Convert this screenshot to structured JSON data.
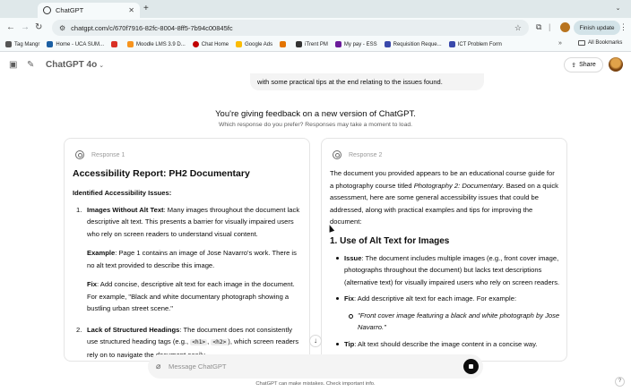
{
  "browser": {
    "tab_title": "ChatGPT",
    "tab_close": "✕",
    "new_tab": "+",
    "url": "chatgpt.com/c/670f7916-82fc-8004-8ff5-7b94c00845fc",
    "finish_update": "Finish update",
    "bookmarks": [
      {
        "label": "Tag Mangr",
        "icon_color": "#555555"
      },
      {
        "label": "Home - UCA SUM...",
        "icon_color": "#1b5fa3"
      },
      {
        "label": "",
        "icon_color": "#d93025"
      },
      {
        "label": "Moodle LMS 3.9 D...",
        "icon_color": "#f7941e"
      },
      {
        "label": "Chat Home",
        "icon_color": "#c00000"
      },
      {
        "label": "Google Ads",
        "icon_color": "#fbbc04"
      },
      {
        "label": "",
        "icon_color": "#e37400"
      },
      {
        "label": "iTrent PM",
        "icon_color": "#333333"
      },
      {
        "label": "My pay - ESS",
        "icon_color": "#6a1b9a"
      },
      {
        "label": "Requisition Reque...",
        "icon_color": "#3949ab"
      },
      {
        "label": "ICT Problem Form",
        "icon_color": "#3949ab"
      }
    ],
    "bookmarks_more": "»",
    "all_bookmarks": "All Bookmarks"
  },
  "header": {
    "model": "ChatGPT 4o",
    "share": "Share"
  },
  "prior_message": "with some practical tips at the end relating to the issues found.",
  "feedback": {
    "title": "You're giving feedback on a new version of ChatGPT.",
    "subtitle": "Which response do you prefer? Responses may take a moment to load."
  },
  "response1": {
    "label": "Response 1",
    "heading": "Accessibility Report: PH2 Documentary",
    "subheading": "Identified Accessibility Issues:",
    "item1_num": "1.",
    "item1_title": "Images Without Alt Text",
    "item1_text": ": Many images throughout the document lack descriptive alt text. This presents a barrier for visually impaired users who rely on screen readers to understand visual content.",
    "item1_example_label": "Example",
    "item1_example": ": Page 1 contains an image of Jose Navarro's work. There is no alt text provided to describe this image.",
    "item1_fix_label": "Fix",
    "item1_fix": ": Add concise, descriptive alt text for each image in the document. For example, \"Black and white documentary photograph showing a bustling urban street scene.\"",
    "item2_num": "2.",
    "item2_title": "Lack of Structured Headings",
    "item2_text_a": ": The document does not consistently use structured heading tags (e.g., ",
    "item2_code1": "<h1>",
    "item2_sep": ", ",
    "item2_code2": "<h2>",
    "item2_text_b": "), which screen readers rely on to navigate the document easily."
  },
  "response2": {
    "label": "Response 2",
    "intro_a": "The document you provided appears to be an educational course guide for a photography course titled ",
    "intro_em": "Photography 2: Documentary",
    "intro_b": ". Based on a quick assessment, here are some general accessibility issues that could be addressed, along with practical examples and tips for improving the document:",
    "section_heading": "1. Use of Alt Text for Images",
    "issue_label": "Issue",
    "issue_text": ": The document includes multiple images (e.g., front cover image, photographs throughout the document) but lacks text descriptions (alternative text) for visually impaired users who rely on screen readers.",
    "fix_label": "Fix",
    "fix_text": ": Add descriptive alt text for each image. For example:",
    "example_quote": "\"Front cover image featuring a black and white photograph by Jose Navarro.\"",
    "tip_label": "Tip",
    "tip_text": ": Alt text should describe the image content in a concise way."
  },
  "composer": {
    "placeholder": "Message ChatGPT"
  },
  "disclaimer": "ChatGPT can make mistakes. Check important info.",
  "help": "?",
  "scroll_down": "↓"
}
